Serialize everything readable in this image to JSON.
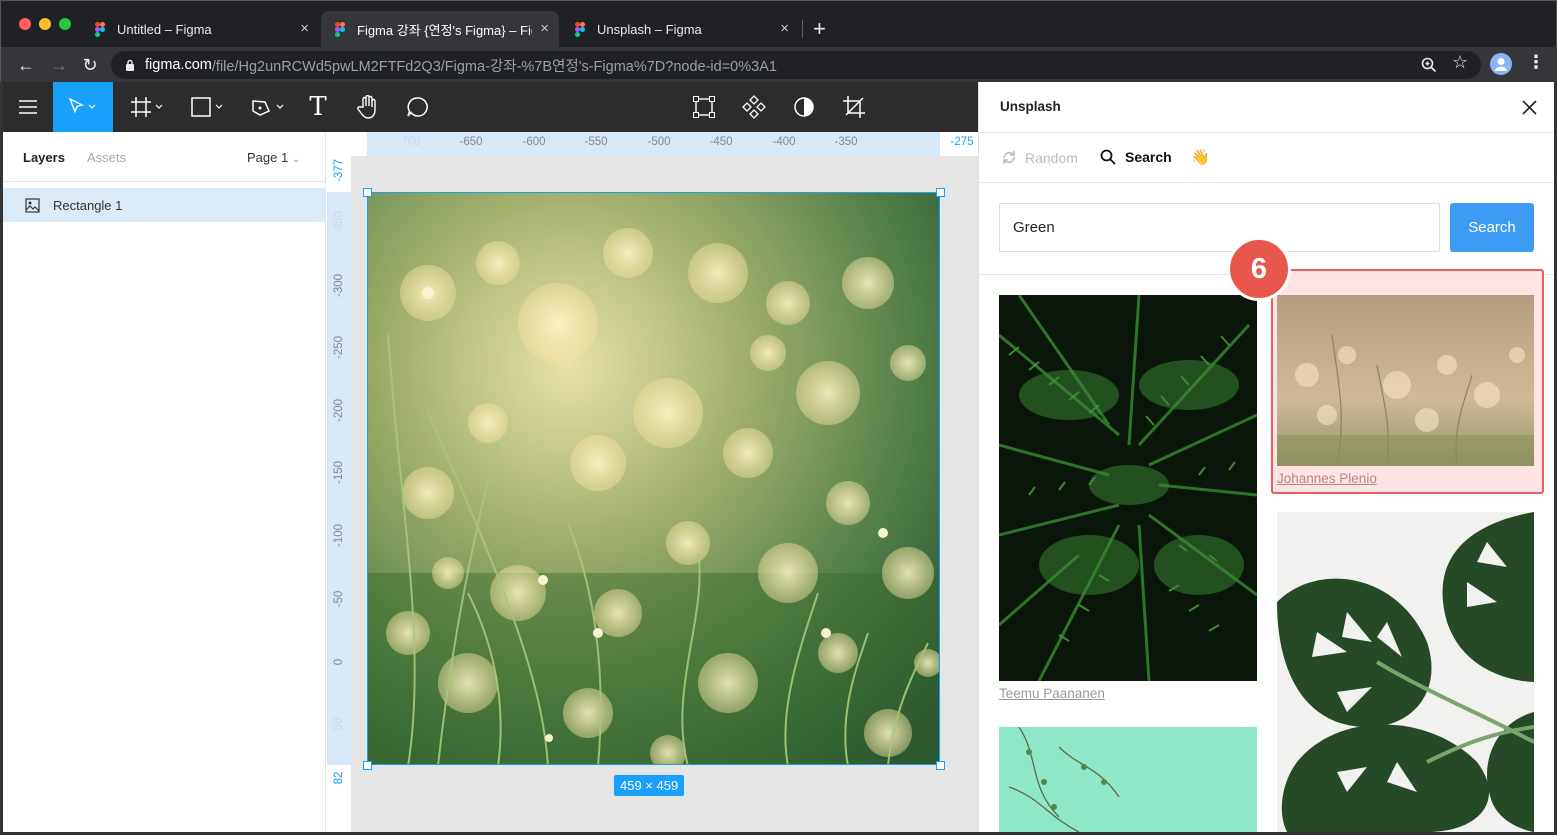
{
  "browser": {
    "tabs": [
      {
        "title": "Untitled – Figma"
      },
      {
        "title": "Figma 강좌 {연정's Figma} – Figm"
      },
      {
        "title": "Unsplash – Figma"
      }
    ],
    "new_tab": "+",
    "close": "×",
    "url_host": "figma.com",
    "url_path": "/file/Hg2unRCWd5pwLM2FTFd2Q3/Figma-강좌-%7B연정's-Figma%7D?node-id=0%3A1"
  },
  "left_panel": {
    "tab_layers": "Layers",
    "tab_assets": "Assets",
    "page": "Page 1",
    "layers": [
      {
        "name": "Rectangle 1"
      }
    ]
  },
  "canvas": {
    "h_ruler": [
      "-700",
      "-650",
      "-600",
      "-550",
      "-500",
      "-450",
      "-400",
      "-350",
      "-275"
    ],
    "v_ruler": [
      "-377",
      "-350",
      "-300",
      "-250",
      "-200",
      "-150",
      "-100",
      "-50",
      "0",
      "50",
      "82"
    ],
    "size_label": "459 × 459"
  },
  "plugin": {
    "title": "Unsplash",
    "tab_random": "Random",
    "tab_search": "Search",
    "tab_emoji": "👋",
    "search_value": "Green",
    "search_button": "Search",
    "results": [
      {
        "credit": "Teemu Paananen"
      },
      {
        "credit": "Johannes Plenio"
      }
    ],
    "step_badge": "6"
  },
  "colors": {
    "accent": "#18a0fb",
    "highlight": "#e85f5f",
    "search_button": "#3d9bf3"
  }
}
